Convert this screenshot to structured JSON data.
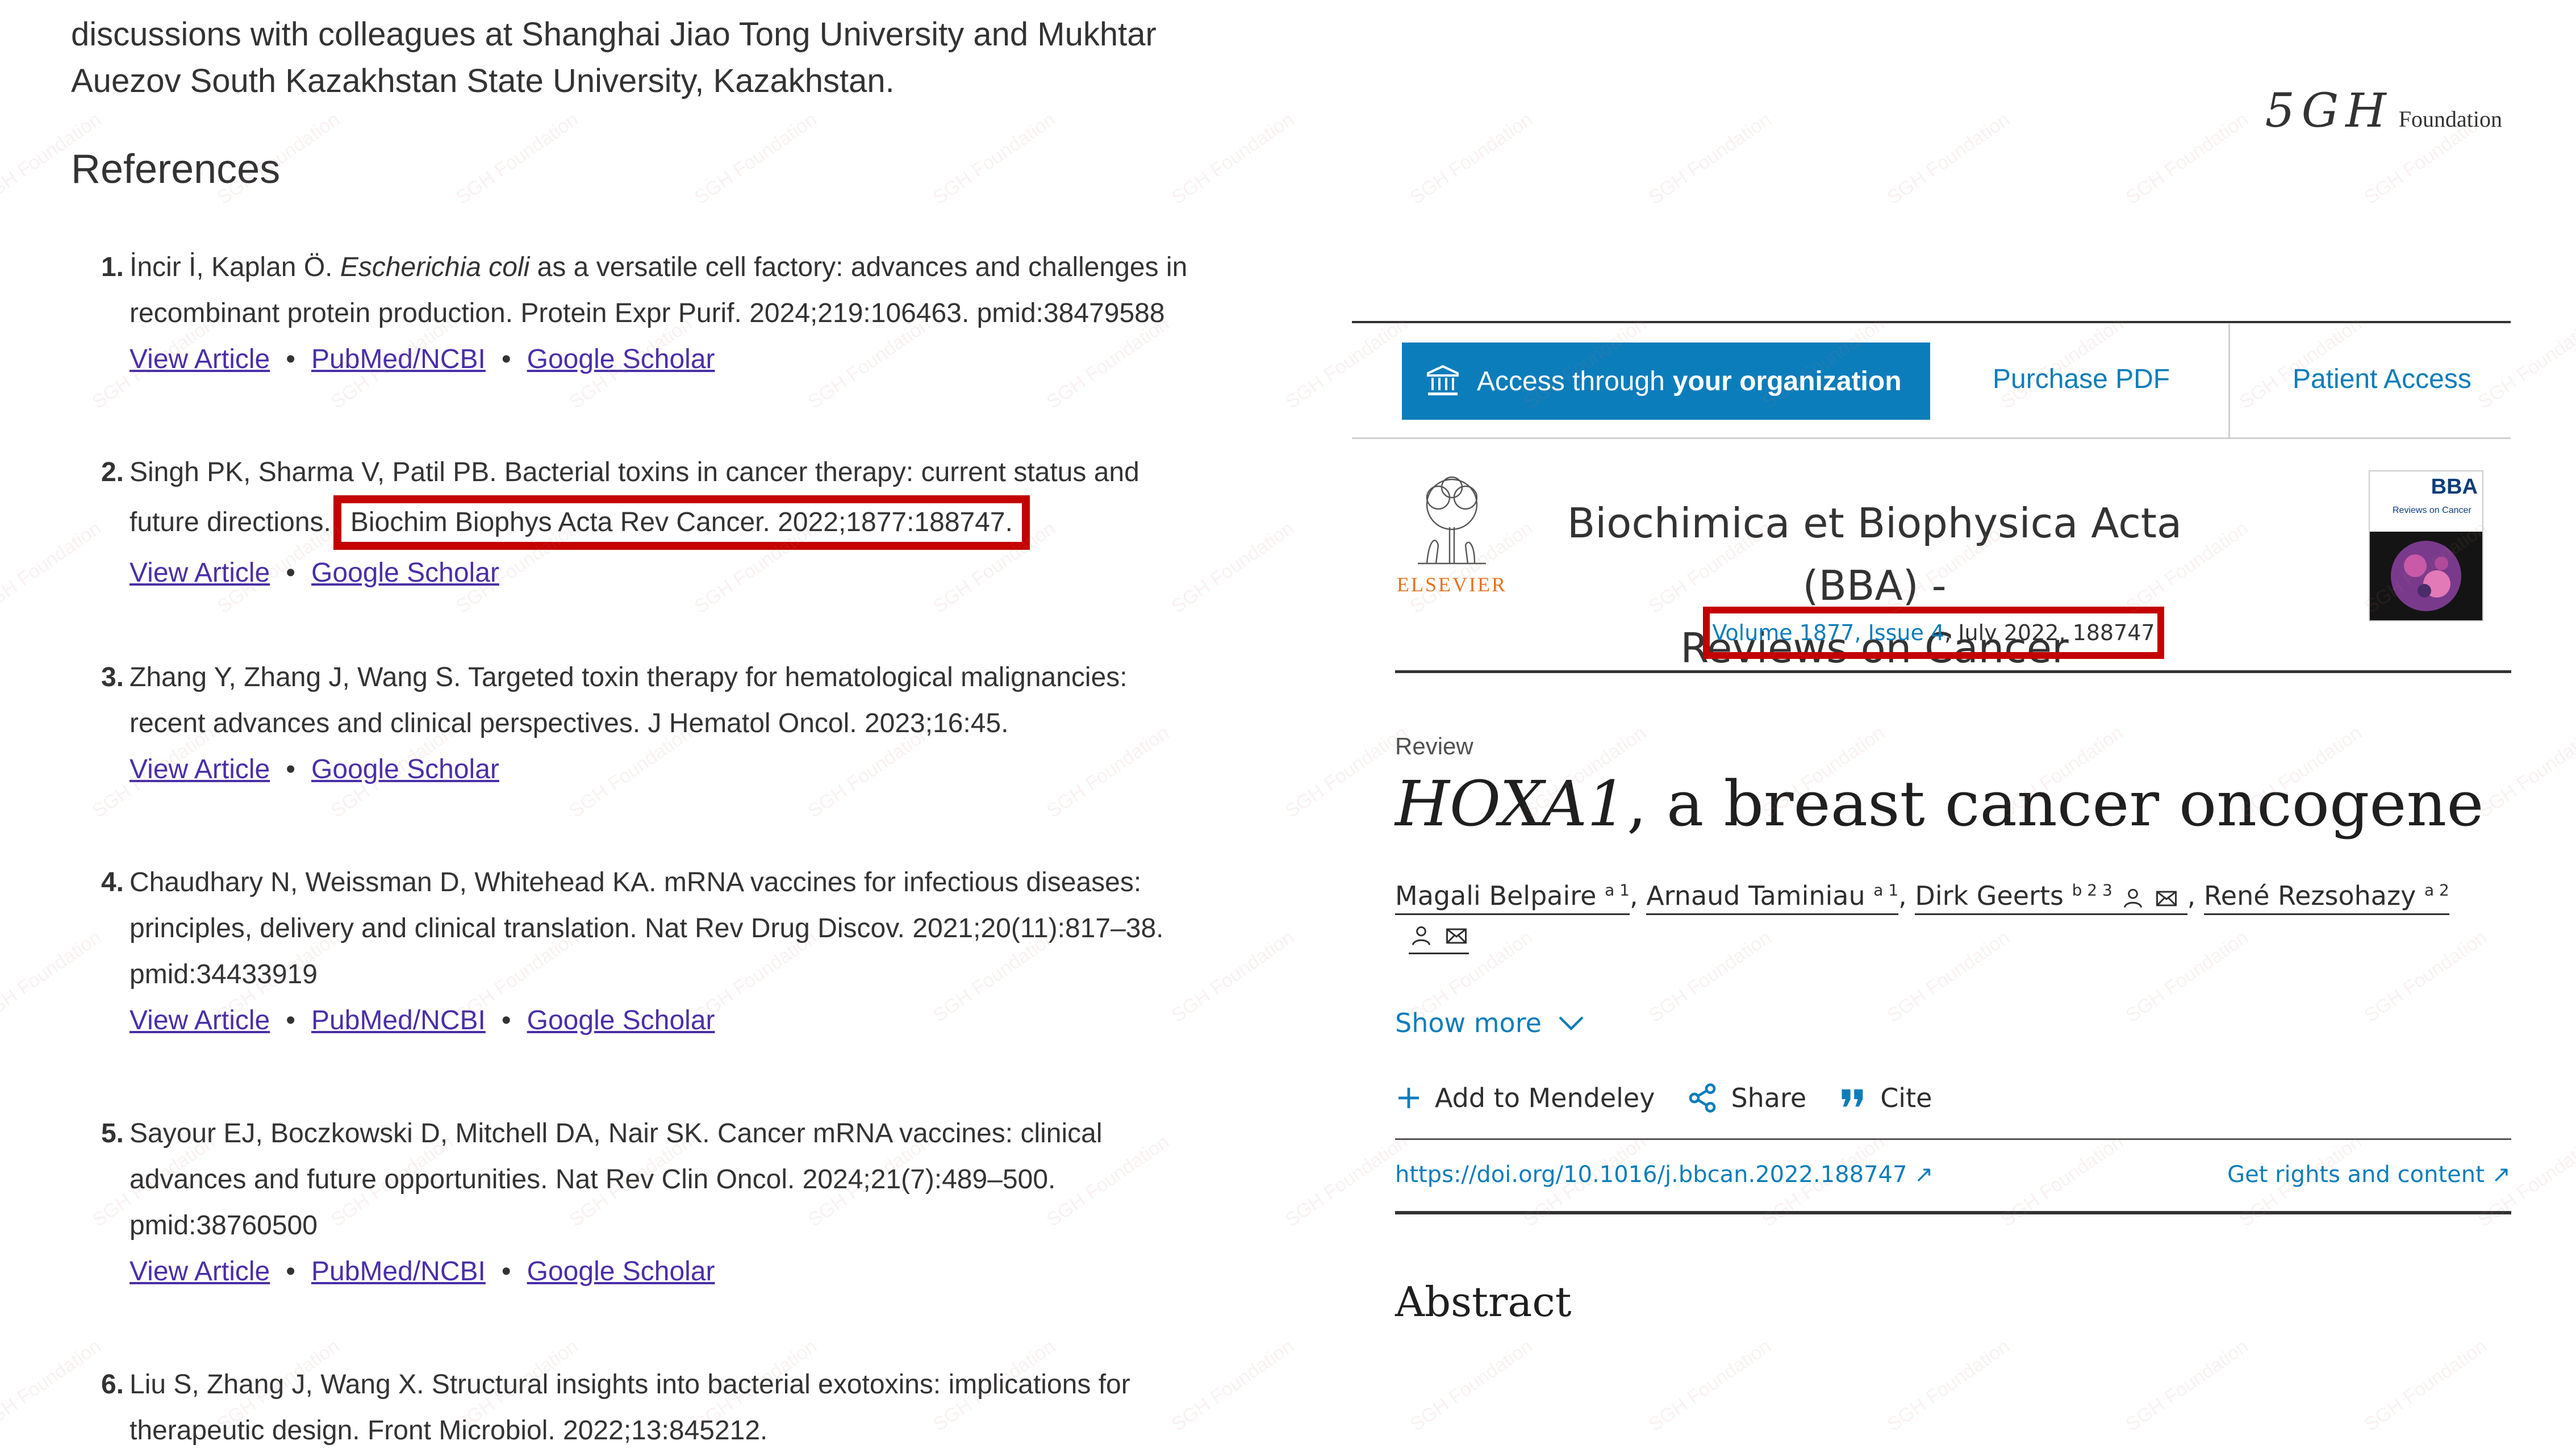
{
  "left": {
    "intro_lines": [
      "discussions with colleagues at Shanghai Jiao Tong University and Mukhtar",
      "Auezov South Kazakhstan State University, Kazakhstan."
    ],
    "references_heading": "References",
    "link_labels": {
      "view_article": "View Article",
      "pubmed": "PubMed/NCBI",
      "google_scholar": "Google Scholar",
      "separator": "•"
    },
    "refs": [
      {
        "num": "1.",
        "line1_a": "İncir İ, Kaplan Ö. ",
        "line1_italic": "Escherichia coli",
        "line1_b": " as a versatile cell factory: advances and challenges in",
        "line2": "recombinant protein production. Protein Expr Purif. 2024;219:106463. pmid:38479588"
      },
      {
        "num": "2.",
        "line1": "Singh PK, Sharma V, Patil PB. Bacterial toxins in cancer therapy: current status and",
        "line2_a": "future directions.",
        "line2_highlight": "Biochim Biophys Acta Rev Cancer. 2022;1877:188747."
      },
      {
        "num": "3.",
        "line1": "Zhang Y, Zhang J, Wang S. Targeted toxin therapy for hematological malignancies:",
        "line2": "recent advances and clinical perspectives. J Hematol Oncol. 2023;16:45."
      },
      {
        "num": "4.",
        "line1": "Chaudhary N, Weissman D, Whitehead KA. mRNA vaccines for infectious diseases:",
        "line2": "principles, delivery and clinical translation. Nat Rev Drug Discov. 2021;20(11):817–38.",
        "line3": "pmid:34433919"
      },
      {
        "num": "5.",
        "line1": "Sayour EJ, Boczkowski D, Mitchell DA, Nair SK. Cancer mRNA vaccines: clinical",
        "line2": "advances and future opportunities. Nat Rev Clin Oncol. 2024;21(7):489–500.",
        "line3": "pmid:38760500"
      },
      {
        "num": "6.",
        "line1": "Liu S, Zhang J, Wang X. Structural insights into bacterial exotoxins: implications for",
        "line2": "therapeutic design. Front Microbiol. 2022;13:845212."
      }
    ]
  },
  "right": {
    "logo_mark": "5GH",
    "logo_word": "Foundation",
    "access_prefix": "Access through",
    "access_bold": "your organization",
    "purchase": "Purchase PDF",
    "patient": "Patient Access",
    "publisher": "ELSEVIER",
    "journal_title_line1": "Biochimica et Biophysica Acta (BBA) -",
    "journal_title_line2": "Reviews on Cancer",
    "cover_title": "BBA",
    "cover_sub": "Reviews on Cancer",
    "volume_link": "Volume 1877, Issue 4",
    "volume_rest": ", July 2022, 188747",
    "article_type": "Review",
    "title_italic": "HOXA1",
    "title_rest": ", a breast cancer oncogene",
    "authors": [
      {
        "name": "Magali Belpaire",
        "sup": "a 1"
      },
      {
        "name": "Arnaud Taminiau",
        "sup": "a 1"
      },
      {
        "name": "Dirk Geerts",
        "sup": "b 2 3"
      },
      {
        "name": "René Rezsohazy",
        "sup": "a 2"
      }
    ],
    "show_more": "Show more",
    "add_mendeley": "Add to Mendeley",
    "share": "Share",
    "cite": "Cite",
    "doi": "https://doi.org/10.1016/j.bbcan.2022.188747",
    "rights": "Get rights and content",
    "abstract": "Abstract",
    "watermark_text": "SGH Foundation",
    "colors": {
      "link": "#0c7dbb",
      "highlight": "#c40000",
      "ref_link": "#4a2fa8",
      "elsevier": "#e9711c"
    }
  }
}
